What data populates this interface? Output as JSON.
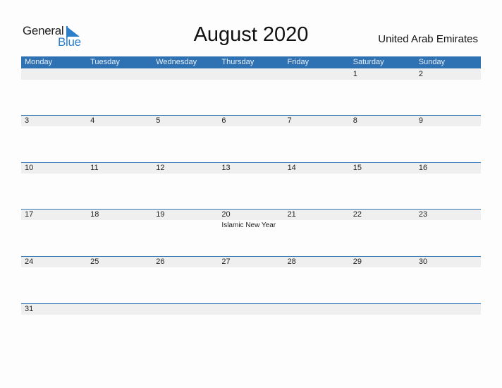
{
  "logo": {
    "word1": "General",
    "word2": "Blue"
  },
  "title": "August 2020",
  "country": "United Arab Emirates",
  "colors": {
    "accent": "#2e72b4",
    "logo_blue": "#2e7fc9",
    "date_strip": "#efefef"
  },
  "days_of_week": [
    "Monday",
    "Tuesday",
    "Wednesday",
    "Thursday",
    "Friday",
    "Saturday",
    "Sunday"
  ],
  "weeks": [
    {
      "days": [
        "",
        "",
        "",
        "",
        "",
        "1",
        "2"
      ],
      "events": [
        "",
        "",
        "",
        "",
        "",
        "",
        ""
      ]
    },
    {
      "days": [
        "3",
        "4",
        "5",
        "6",
        "7",
        "8",
        "9"
      ],
      "events": [
        "",
        "",
        "",
        "",
        "",
        "",
        ""
      ]
    },
    {
      "days": [
        "10",
        "11",
        "12",
        "13",
        "14",
        "15",
        "16"
      ],
      "events": [
        "",
        "",
        "",
        "",
        "",
        "",
        ""
      ]
    },
    {
      "days": [
        "17",
        "18",
        "19",
        "20",
        "21",
        "22",
        "23"
      ],
      "events": [
        "",
        "",
        "",
        "Islamic New Year",
        "",
        "",
        ""
      ]
    },
    {
      "days": [
        "24",
        "25",
        "26",
        "27",
        "28",
        "29",
        "30"
      ],
      "events": [
        "",
        "",
        "",
        "",
        "",
        "",
        ""
      ]
    },
    {
      "days": [
        "31",
        "",
        "",
        "",
        "",
        "",
        ""
      ],
      "events": [
        "",
        "",
        "",
        "",
        "",
        "",
        ""
      ]
    }
  ]
}
